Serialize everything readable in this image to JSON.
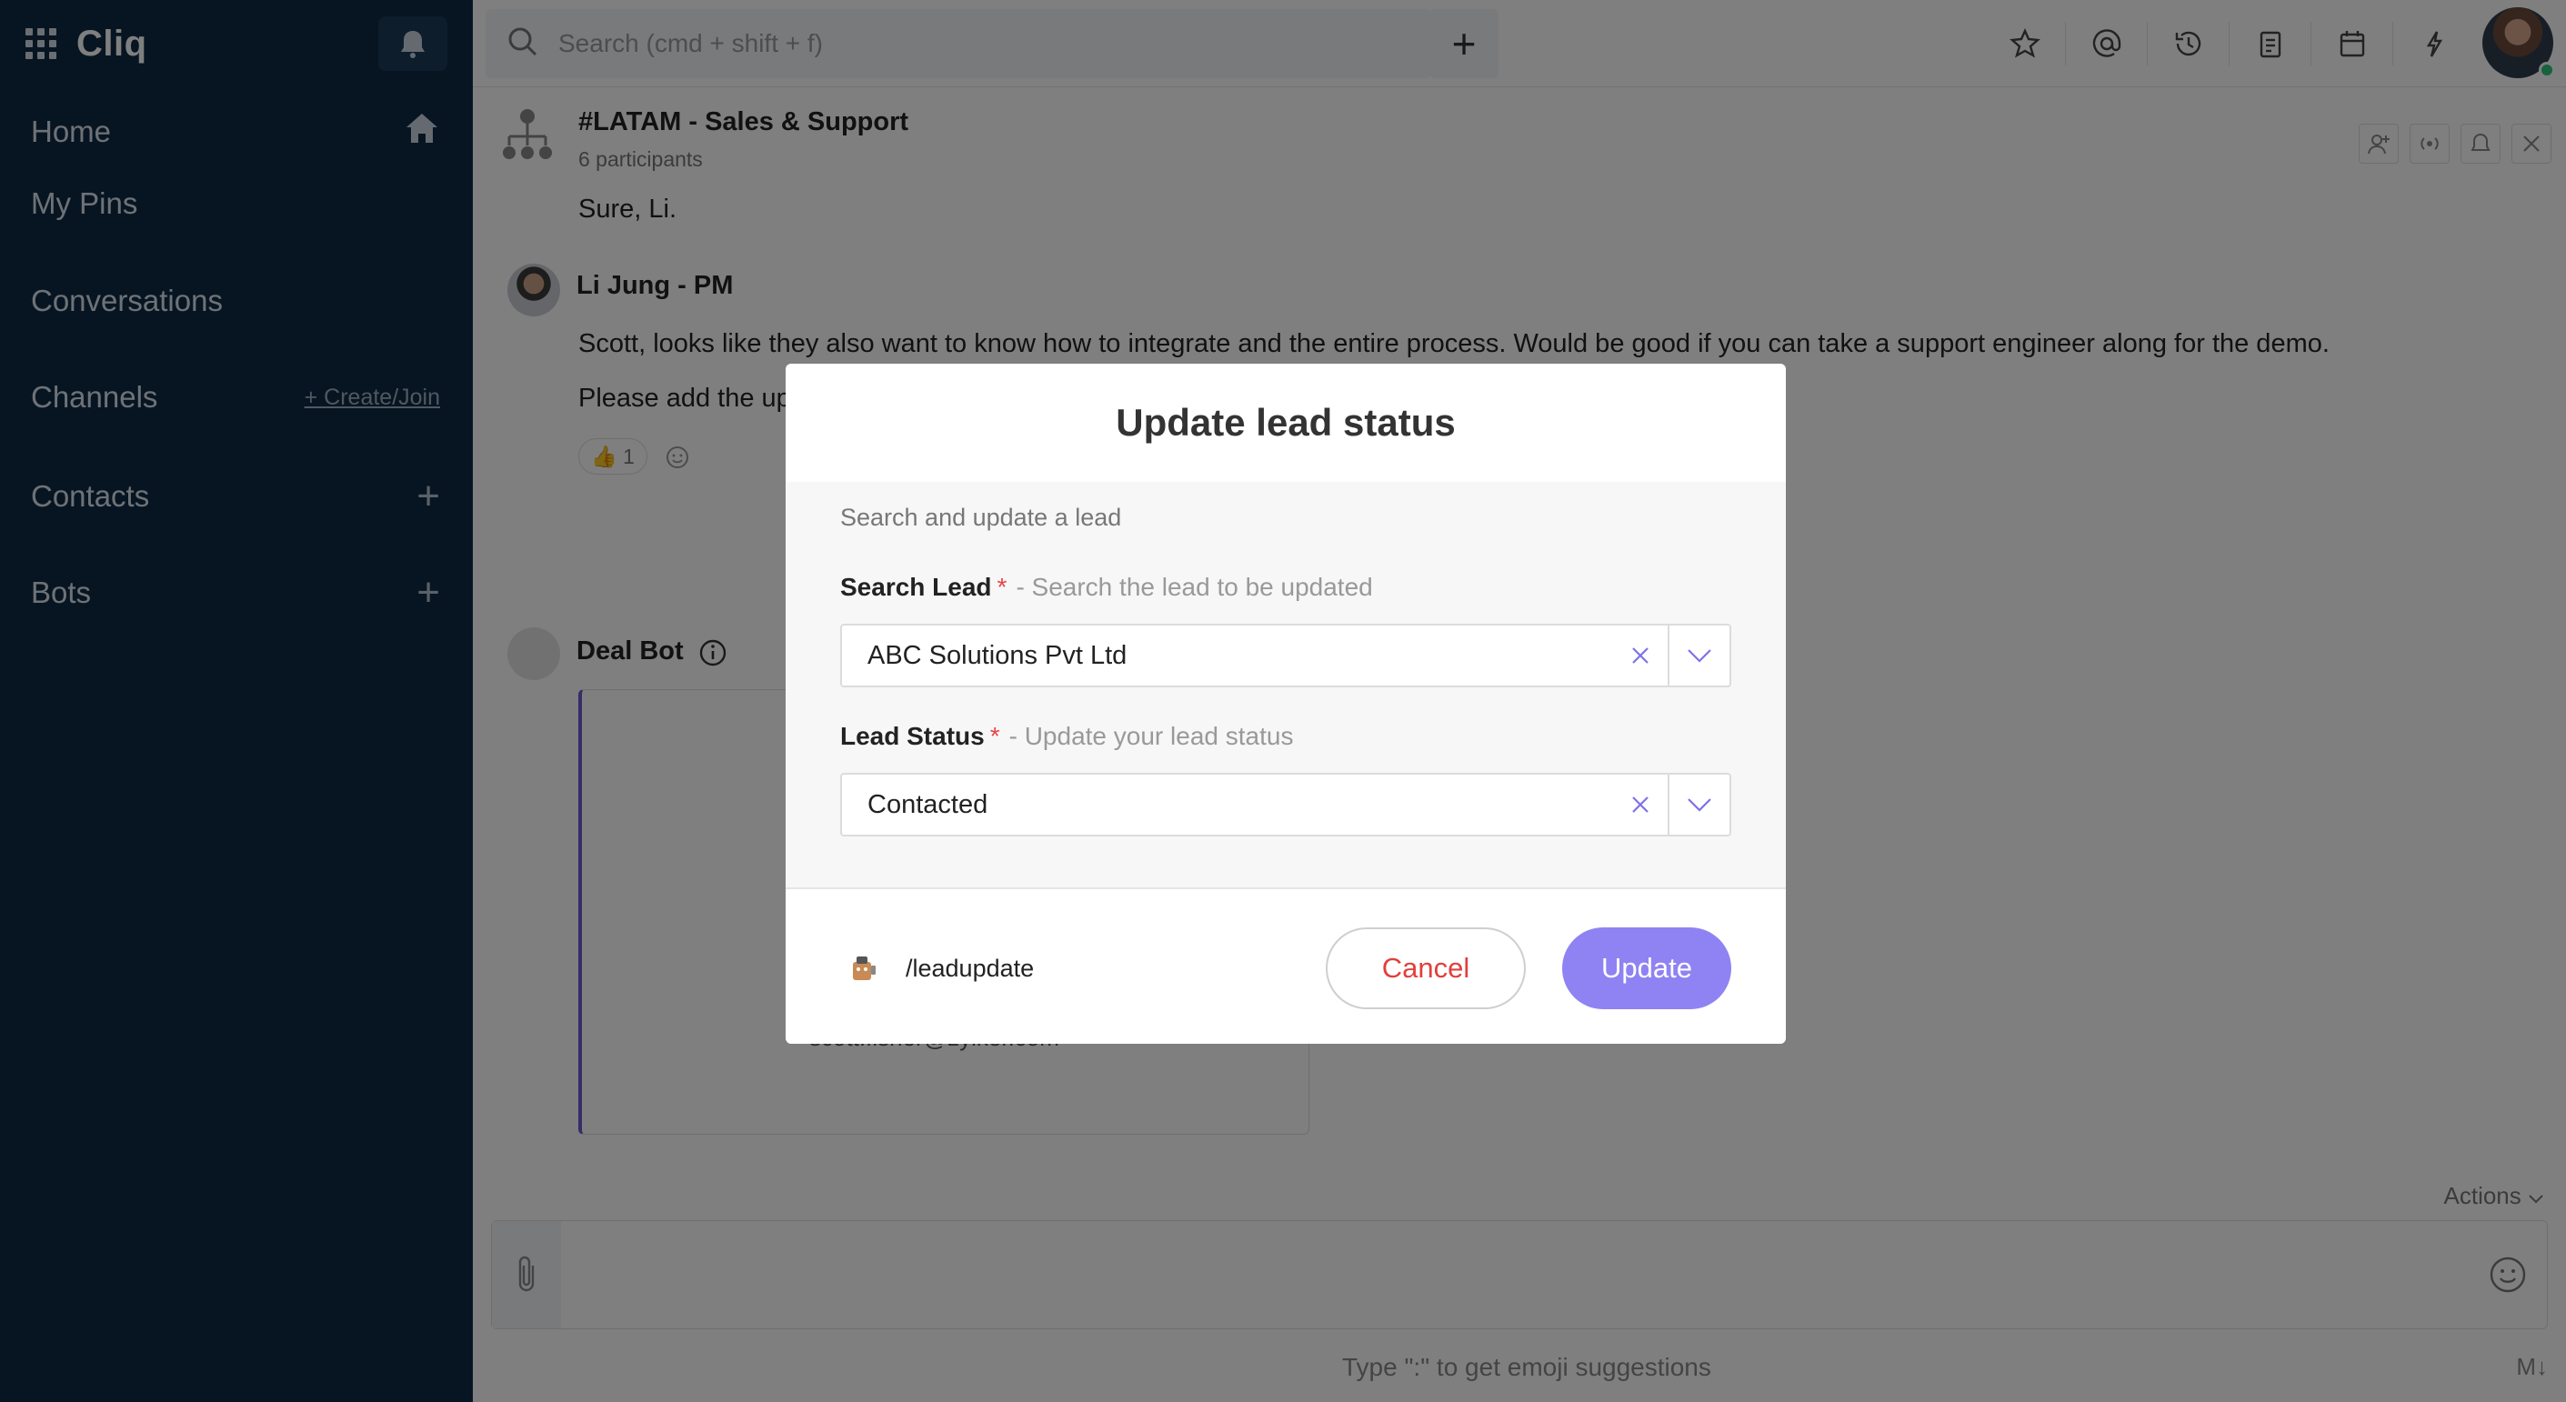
{
  "app": {
    "brand": "Cliq",
    "search_placeholder": "Search (cmd + shift + f)"
  },
  "sidebar": {
    "items": [
      {
        "label": "Home"
      },
      {
        "label": "My Pins"
      },
      {
        "label": "Conversations"
      },
      {
        "label": "Channels",
        "action": "+ Create/Join"
      },
      {
        "label": "Contacts"
      },
      {
        "label": "Bots"
      }
    ]
  },
  "channel": {
    "title": "#LATAM - Sales & Support",
    "participants": "6 participants"
  },
  "messages": {
    "m1": "Sure, Li.",
    "sender2": "Li Jung - PM",
    "m2": "Scott, looks like they also want to know how to integrate and the entire process. Would be good if you can take a support engineer along for the demo.",
    "m3": "Please add the up",
    "reaction": "👍 1",
    "sender3": "Deal Bot",
    "card_email": "scott.fisher@zylker.com"
  },
  "composer": {
    "actions": "Actions",
    "hint": "Type \":\" to get emoji suggestions",
    "format": "M↓"
  },
  "modal": {
    "title": "Update lead status",
    "description": "Search and update a lead",
    "fields": [
      {
        "label": "Search Lead",
        "required": "*",
        "hint": "-  Search the lead to be updated",
        "value": "ABC Solutions Pvt Ltd"
      },
      {
        "label": "Lead Status",
        "required": "*",
        "hint": "-  Update your lead status",
        "value": "Contacted"
      }
    ],
    "command": "/leadupdate",
    "cancel": "Cancel",
    "update": "Update"
  },
  "colors": {
    "sidebar": "#0f2a44",
    "accent": "#8f83f3",
    "danger": "#e0403c"
  }
}
